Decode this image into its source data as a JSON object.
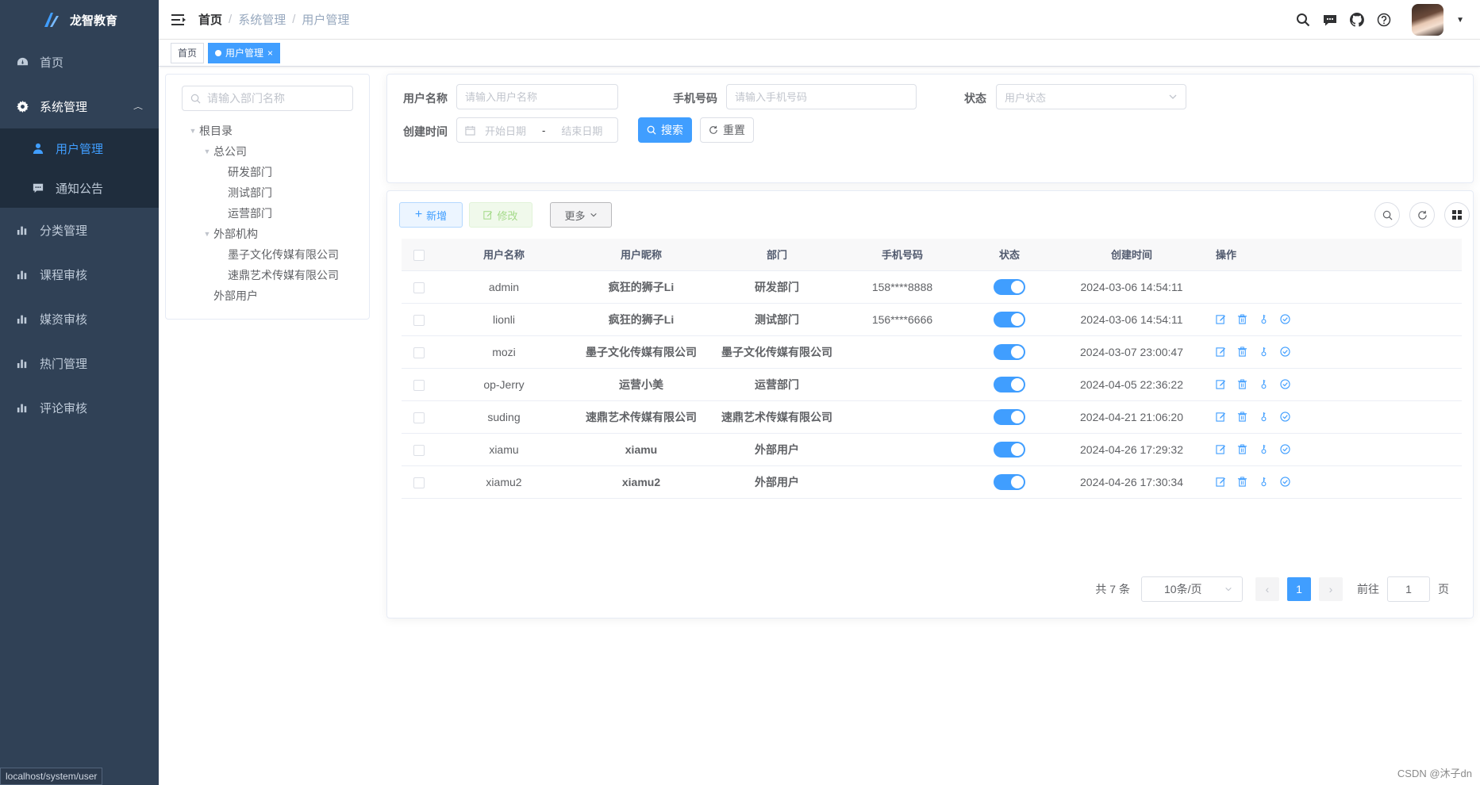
{
  "app": {
    "title": "龙智教育"
  },
  "sidebar": {
    "items": [
      {
        "label": "首页",
        "icon": "dashboard-icon"
      },
      {
        "label": "系统管理",
        "icon": "gear-icon",
        "expanded": true,
        "children": [
          {
            "label": "用户管理",
            "icon": "user-icon",
            "active": true
          },
          {
            "label": "通知公告",
            "icon": "message-icon"
          }
        ]
      },
      {
        "label": "分类管理",
        "icon": "bar-chart-icon"
      },
      {
        "label": "课程审核",
        "icon": "bar-chart-icon"
      },
      {
        "label": "媒资审核",
        "icon": "bar-chart-icon"
      },
      {
        "label": "热门管理",
        "icon": "bar-chart-icon"
      },
      {
        "label": "评论审核",
        "icon": "bar-chart-icon"
      }
    ]
  },
  "status_url": "localhost/system/user",
  "breadcrumb": {
    "items": [
      "首页",
      "系统管理",
      "用户管理"
    ]
  },
  "tags": {
    "home": "首页",
    "current": "用户管理"
  },
  "dept_tree": {
    "search_placeholder": "请输入部门名称",
    "nodes": [
      {
        "label": "根目录",
        "level": 0,
        "expandable": true
      },
      {
        "label": "总公司",
        "level": 1,
        "expandable": true
      },
      {
        "label": "研发部门",
        "level": 2,
        "expandable": false
      },
      {
        "label": "测试部门",
        "level": 2,
        "expandable": false
      },
      {
        "label": "运营部门",
        "level": 2,
        "expandable": false
      },
      {
        "label": "外部机构",
        "level": 1,
        "expandable": true
      },
      {
        "label": "墨子文化传媒有限公司",
        "level": 2,
        "expandable": false
      },
      {
        "label": "速鼎艺术传媒有限公司",
        "level": 2,
        "expandable": false
      },
      {
        "label": "外部用户",
        "level": 1,
        "expandable": false
      }
    ]
  },
  "search": {
    "username_label": "用户名称",
    "username_placeholder": "请输入用户名称",
    "phone_label": "手机号码",
    "phone_placeholder": "请输入手机号码",
    "status_label": "状态",
    "status_placeholder": "用户状态",
    "created_label": "创建时间",
    "start_placeholder": "开始日期",
    "range_sep": "-",
    "end_placeholder": "结束日期",
    "search_button": "搜索",
    "reset_button": "重置"
  },
  "toolbar": {
    "add": "新增",
    "edit": "修改",
    "more": "更多"
  },
  "table": {
    "columns": [
      "用户名称",
      "用户昵称",
      "部门",
      "手机号码",
      "状态",
      "创建时间",
      "操作"
    ],
    "rows": [
      {
        "username": "admin",
        "nickname": "疯狂的狮子Li",
        "dept": "研发部门",
        "phone": "158****8888",
        "enabled": true,
        "created": "2024-03-06 14:54:11",
        "ops": false
      },
      {
        "username": "lionli",
        "nickname": "疯狂的狮子Li",
        "dept": "测试部门",
        "phone": "156****6666",
        "enabled": true,
        "created": "2024-03-06 14:54:11",
        "ops": true
      },
      {
        "username": "mozi",
        "nickname": "墨子文化传媒有限公司",
        "dept": "墨子文化传媒有限公司",
        "phone": "",
        "enabled": true,
        "created": "2024-03-07 23:00:47",
        "ops": true
      },
      {
        "username": "op-Jerry",
        "nickname": "运营小美",
        "dept": "运营部门",
        "phone": "",
        "enabled": true,
        "created": "2024-04-05 22:36:22",
        "ops": true
      },
      {
        "username": "suding",
        "nickname": "速鼎艺术传媒有限公司",
        "dept": "速鼎艺术传媒有限公司",
        "phone": "",
        "enabled": true,
        "created": "2024-04-21 21:06:20",
        "ops": true
      },
      {
        "username": "xiamu",
        "nickname": "xiamu",
        "dept": "外部用户",
        "phone": "",
        "enabled": true,
        "created": "2024-04-26 17:29:32",
        "ops": true
      },
      {
        "username": "xiamu2",
        "nickname": "xiamu2",
        "dept": "外部用户",
        "phone": "",
        "enabled": true,
        "created": "2024-04-26 17:30:34",
        "ops": true
      }
    ]
  },
  "pagination": {
    "total_text": "共 7 条",
    "page_size": "10条/页",
    "current_page": "1",
    "goto_label": "前往",
    "goto_value": "1",
    "page_suffix": "页"
  },
  "watermark": "CSDN @沐子dn",
  "colors": {
    "sidebar_bg": "#304156",
    "submenu_bg": "#1f2d3d",
    "primary": "#409eff"
  }
}
